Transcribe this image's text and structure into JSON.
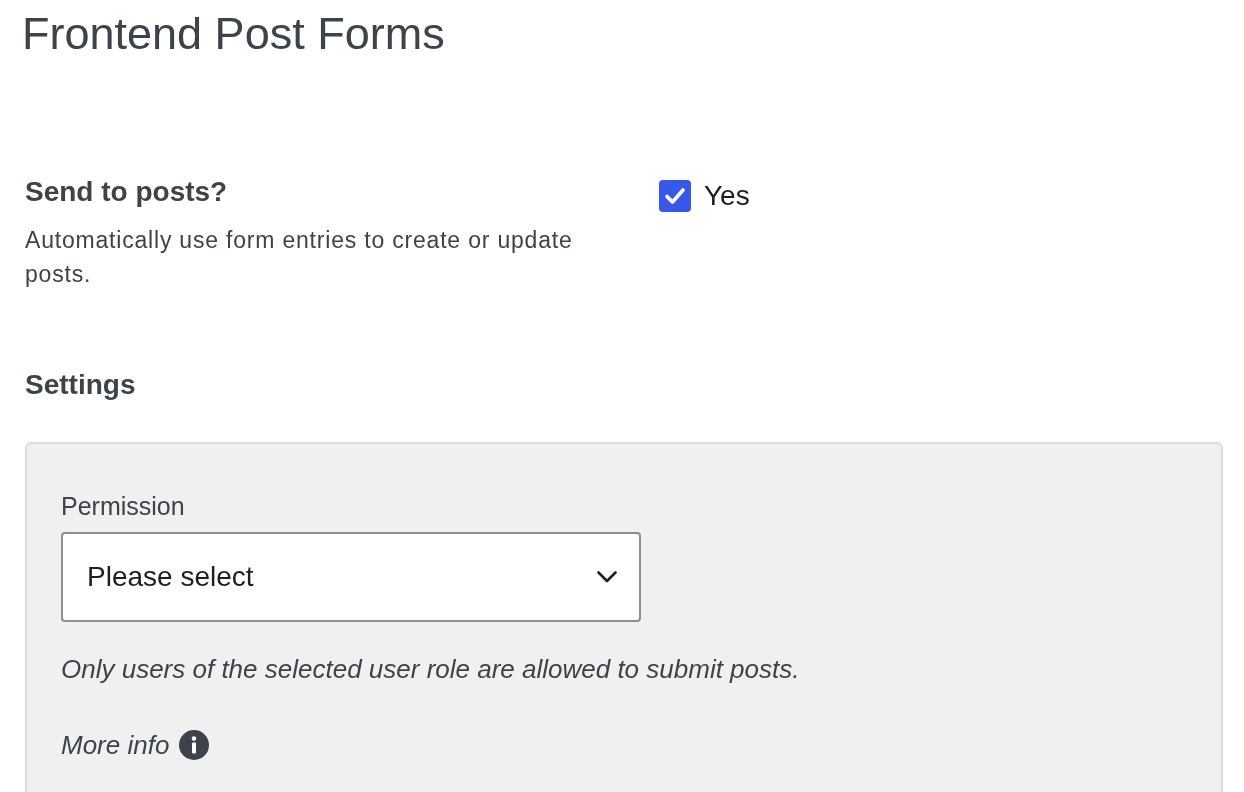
{
  "page": {
    "title": "Frontend Post Forms"
  },
  "send_to_posts": {
    "label": "Send to posts?",
    "description": "Automatically use form entries to create or update posts.",
    "checkbox": {
      "label": "Yes",
      "checked": true
    }
  },
  "settings": {
    "heading": "Settings",
    "permission": {
      "label": "Permission",
      "value": "Please select",
      "help": "Only users of the selected user role are allowed to submit posts.",
      "more_info": "More info"
    }
  }
}
